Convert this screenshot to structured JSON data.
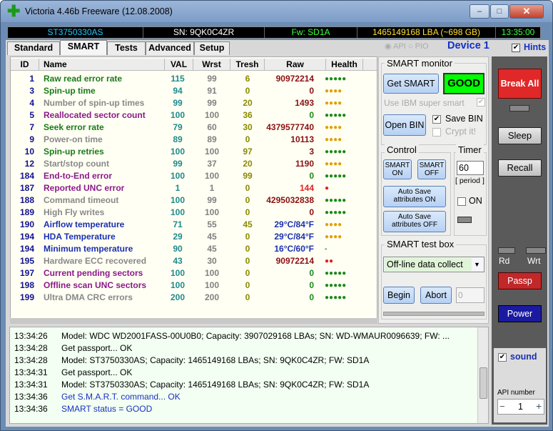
{
  "window": {
    "title": "Victoria 4.46b Freeware (12.08.2008)",
    "minimize_label": "–",
    "maximize_label": "□",
    "close_label": "✕"
  },
  "infobar": {
    "model": "ST3750330AS",
    "serial": "SN: 9QK0C4ZR",
    "firmware": "Fw: SD1A",
    "capacity": "1465149168 LBA (~698 GB)",
    "time": "13:35:00"
  },
  "tabs": [
    {
      "label": "Standard"
    },
    {
      "label": "SMART"
    },
    {
      "label": "Tests"
    },
    {
      "label": "Advanced"
    },
    {
      "label": "Setup"
    }
  ],
  "mode": {
    "api_label": "API",
    "pio_label": "PIO",
    "device_label": "Device 1",
    "hints_label": "Hints",
    "hints_checked": "✔"
  },
  "table": {
    "headers": {
      "id": "ID",
      "name": "Name",
      "val": "VAL",
      "wrst": "Wrst",
      "tresh": "Tresh",
      "raw": "Raw",
      "health": "Health"
    },
    "rows": [
      {
        "id": "1",
        "name": "Raw read error rate",
        "val": "115",
        "wrst": "99",
        "tresh": "6",
        "raw": "90972214",
        "health": "●●●●●",
        "name_color": "#1a7a1a",
        "raw_color": "#8a1010",
        "health_color": "#1a8a1a"
      },
      {
        "id": "3",
        "name": "Spin-up time",
        "val": "94",
        "wrst": "91",
        "tresh": "0",
        "raw": "0",
        "health": "●●●●",
        "name_color": "#1a7a1a",
        "raw_color": "#8a1010",
        "health_color": "#e0a000"
      },
      {
        "id": "4",
        "name": "Number of spin-up times",
        "val": "99",
        "wrst": "99",
        "tresh": "20",
        "raw": "1493",
        "health": "●●●●",
        "name_color": "#888888",
        "raw_color": "#8a1010",
        "health_color": "#e0a000"
      },
      {
        "id": "5",
        "name": "Reallocated sector count",
        "val": "100",
        "wrst": "100",
        "tresh": "36",
        "raw": "0",
        "health": "●●●●●",
        "name_color": "#8a1a8a",
        "raw_color": "#1a8a1a",
        "health_color": "#1a8a1a"
      },
      {
        "id": "7",
        "name": "Seek error rate",
        "val": "79",
        "wrst": "60",
        "tresh": "30",
        "raw": "4379577740",
        "health": "●●●●",
        "name_color": "#1a7a1a",
        "raw_color": "#8a1010",
        "health_color": "#e0a000"
      },
      {
        "id": "9",
        "name": "Power-on time",
        "val": "89",
        "wrst": "89",
        "tresh": "0",
        "raw": "10113",
        "health": "●●●●",
        "name_color": "#888888",
        "raw_color": "#8a1010",
        "health_color": "#e0a000"
      },
      {
        "id": "10",
        "name": "Spin-up retries",
        "val": "100",
        "wrst": "100",
        "tresh": "97",
        "raw": "3",
        "health": "●●●●●",
        "name_color": "#1a7a1a",
        "raw_color": "#8a1010",
        "health_color": "#1a8a1a"
      },
      {
        "id": "12",
        "name": "Start/stop count",
        "val": "99",
        "wrst": "37",
        "tresh": "20",
        "raw": "1190",
        "health": "●●●●",
        "name_color": "#888888",
        "raw_color": "#8a1010",
        "health_color": "#e0a000"
      },
      {
        "id": "184",
        "name": "End-to-End error",
        "val": "100",
        "wrst": "100",
        "tresh": "99",
        "raw": "0",
        "health": "●●●●●",
        "name_color": "#8a1a8a",
        "raw_color": "#1a8a1a",
        "health_color": "#1a8a1a"
      },
      {
        "id": "187",
        "name": "Reported UNC error",
        "val": "1",
        "wrst": "1",
        "tresh": "0",
        "raw": "144",
        "health": "●",
        "name_color": "#8a1a8a",
        "raw_color": "#e02020",
        "health_color": "#e02020"
      },
      {
        "id": "188",
        "name": "Command timeout",
        "val": "100",
        "wrst": "99",
        "tresh": "0",
        "raw": "4295032838",
        "health": "●●●●●",
        "name_color": "#888888",
        "raw_color": "#8a1010",
        "health_color": "#1a8a1a"
      },
      {
        "id": "189",
        "name": "High Fly writes",
        "val": "100",
        "wrst": "100",
        "tresh": "0",
        "raw": "0",
        "health": "●●●●●",
        "name_color": "#888888",
        "raw_color": "#8a1010",
        "health_color": "#1a8a1a"
      },
      {
        "id": "190",
        "name": "Airflow temperature",
        "val": "71",
        "wrst": "55",
        "tresh": "45",
        "raw": "29°C/84°F",
        "health": "●●●●",
        "name_color": "#1a30b0",
        "raw_color": "#1a30b0",
        "health_color": "#e0a000"
      },
      {
        "id": "194",
        "name": "HDA Temperature",
        "val": "29",
        "wrst": "45",
        "tresh": "0",
        "raw": "29°C/84°F",
        "health": "●●●●",
        "name_color": "#1a30b0",
        "raw_color": "#1a30b0",
        "health_color": "#e0a000"
      },
      {
        "id": "194",
        "name": "Minimum temperature",
        "val": "90",
        "wrst": "45",
        "tresh": "0",
        "raw": "16°C/60°F",
        "health": "-",
        "name_color": "#1a30b0",
        "raw_color": "#1a30b0",
        "health_color": "#1a8a1a"
      },
      {
        "id": "195",
        "name": "Hardware ECC recovered",
        "val": "43",
        "wrst": "30",
        "tresh": "0",
        "raw": "90972214",
        "health": "●●",
        "name_color": "#888888",
        "raw_color": "#8a1010",
        "health_color": "#e02020"
      },
      {
        "id": "197",
        "name": "Current pending sectors",
        "val": "100",
        "wrst": "100",
        "tresh": "0",
        "raw": "0",
        "health": "●●●●●",
        "name_color": "#8a1a8a",
        "raw_color": "#1a8a1a",
        "health_color": "#1a8a1a"
      },
      {
        "id": "198",
        "name": "Offline scan UNC sectors",
        "val": "100",
        "wrst": "100",
        "tresh": "0",
        "raw": "0",
        "health": "●●●●●",
        "name_color": "#8a1a8a",
        "raw_color": "#1a8a1a",
        "health_color": "#1a8a1a"
      },
      {
        "id": "199",
        "name": "Ultra DMA CRC errors",
        "val": "200",
        "wrst": "200",
        "tresh": "0",
        "raw": "0",
        "health": "●●●●●",
        "name_color": "#888888",
        "raw_color": "#1a8a1a",
        "health_color": "#1a8a1a"
      }
    ]
  },
  "smart_monitor": {
    "title": "SMART monitor",
    "get_smart_label": "Get SMART",
    "status": "GOOD",
    "ibm_label": "Use IBM super smart",
    "save_bin_label": "Save BIN",
    "open_bin_label": "Open BIN",
    "crypt_label": "Crypt it!",
    "checked": "✔"
  },
  "control": {
    "title": "Control",
    "smart_on_label": "SMART ON",
    "smart_off_label": "SMART OFF",
    "autosave_on_label": "Auto Save attributes ON",
    "autosave_off_label": "Auto Save attributes OFF"
  },
  "timer": {
    "title": "Timer",
    "value": "60",
    "period_label": "[ period ]",
    "on_label": "ON"
  },
  "test_box": {
    "title": "SMART test box",
    "selected": "Off-line data collect",
    "begin_label": "Begin",
    "abort_label": "Abort",
    "field_value": "0"
  },
  "side": {
    "break_all_label": "Break All",
    "sleep_label": "Sleep",
    "recall_label": "Recall",
    "rd_label": "Rd",
    "wrt_label": "Wrt",
    "passp_label": "Passp",
    "power_label": "Power",
    "sound_label": "sound",
    "sound_checked": "✔",
    "api_number_label": "API number",
    "api_number_value": "1",
    "minus_label": "−",
    "plus_label": "+"
  },
  "log": [
    {
      "time": "13:34:26",
      "msg": "Model: WDC WD2001FASS-00U0B0; Capacity: 3907029168 LBAs; SN: WD-WMAUR0096639; FW: ...",
      "color": "#000000"
    },
    {
      "time": "13:34:28",
      "msg": "Get passport... OK",
      "color": "#000000"
    },
    {
      "time": "13:34:28",
      "msg": "Model: ST3750330AS; Capacity: 1465149168 LBAs; SN: 9QK0C4ZR; FW: SD1A",
      "color": "#000000"
    },
    {
      "time": "13:34:31",
      "msg": "Get passport... OK",
      "color": "#000000"
    },
    {
      "time": "13:34:31",
      "msg": "Model: ST3750330AS; Capacity: 1465149168 LBAs; SN: 9QK0C4ZR; FW: SD1A",
      "color": "#000000"
    },
    {
      "time": "13:34:36",
      "msg": "Get S.M.A.R.T. command... OK",
      "color": "#1a30c0"
    },
    {
      "time": "13:34:36",
      "msg": "SMART status = GOOD",
      "color": "#1a30c0"
    }
  ]
}
